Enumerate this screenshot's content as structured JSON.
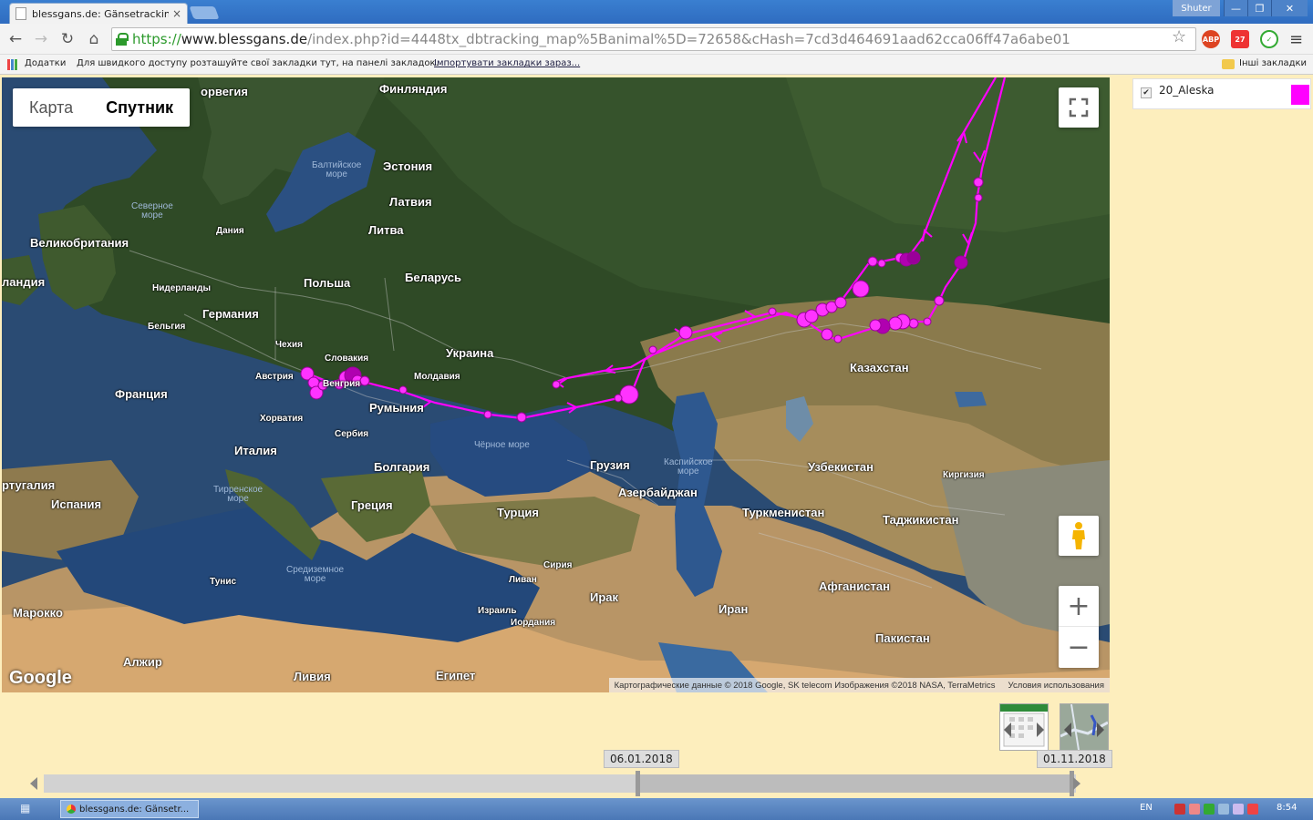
{
  "browser": {
    "tab_title": "blessgans.de: Gänsetracking",
    "tab_close": "×",
    "window_user": "Shuter",
    "window_min": "—",
    "window_max": "❐",
    "window_close": "✕",
    "url_scheme": "https://",
    "url_host": "www.blessgans.de",
    "url_path": "/index.php?id=4448tx_dbtracking_map%5Banimal%5D=72658&cHash=7cd3d464691aad62cca06ff47a6abe01",
    "ext_abp": "ABP",
    "ext_badge": "27"
  },
  "bookmarks": {
    "apps": "Додатки",
    "hint": "Для швидкого доступу розташуйте свої закладки тут, на панелі закладок.",
    "import_link": "Імпортувати закладки зараз...",
    "other": "Інші закладки"
  },
  "map": {
    "type_map": "Карта",
    "type_satellite": "Спутник",
    "google": "Google",
    "attribution": "Картографические данные © 2018 Google, SK telecom Изображения ©2018 NASA, TerraMetrics",
    "terms": "Условия использования",
    "zoom_in": "+",
    "zoom_out": "−",
    "labels": {
      "norway": "орвегия",
      "finland": "Финляндия",
      "estonia": "Эстония",
      "baltic": "Балтийское",
      "baltic2": "море",
      "latvia": "Латвия",
      "lithuania": "Литва",
      "north_sea": "Северное",
      "north_sea2": "море",
      "denmark": "Дания",
      "uk": "Великобритания",
      "ireland": "ландия",
      "netherlands": "Нидерланды",
      "poland": "Польша",
      "belarus": "Беларусь",
      "germany": "Германия",
      "belgium": "Бельгия",
      "czechia": "Чехия",
      "slovakia": "Словакия",
      "ukraine": "Украина",
      "austria": "Австрия",
      "hungary": "Венгрия",
      "moldova": "Молдавия",
      "france": "Франция",
      "romania": "Румыния",
      "croatia": "Хорватия",
      "serbia": "Сербия",
      "italy": "Италия",
      "black_sea": "Чёрное море",
      "bulgaria": "Болгария",
      "georgia": "Грузия",
      "caspian": "Каспийское",
      "caspian2": "море",
      "portugal": "ртугалия",
      "spain": "Испания",
      "tyrrhenian": "Тирренское",
      "tyrrhenian2": "море",
      "greece": "Греция",
      "turkey": "Турция",
      "azerbaijan": "Азербайджан",
      "kazakhstan": "Казахстан",
      "uzbekistan": "Узбекистан",
      "kyrgyzstan": "Киргизия",
      "turkmenistan": "Туркменистан",
      "tajikistan": "Таджикистан",
      "tunisia": "Тунис",
      "mediterranean": "Средиземное",
      "mediterranean2": "море",
      "syria": "Сирия",
      "lebanon": "Ливан",
      "iraq": "Ирак",
      "iran": "Иран",
      "afghanistan": "Афганистан",
      "morocco": "Марокко",
      "israel": "Израиль",
      "jordan": "Иордания",
      "pakistan": "Пакистан",
      "algeria": "Алжир",
      "libya": "Ливия",
      "egypt": "Египет"
    }
  },
  "legend": {
    "checked": "✔",
    "animal_name": "20_Aleska",
    "animal_color": "#ff00ff"
  },
  "timeline": {
    "start_date": "06.01.2018",
    "end_date": "01.11.2018"
  },
  "taskbar": {
    "task_label": "blessgans.de: Gänsetr...",
    "lang": "EN",
    "time": "8:54"
  },
  "colors": {
    "track": "#ff00ff",
    "page_bg": "#fdeebd",
    "accent": "#2c9a2c"
  }
}
